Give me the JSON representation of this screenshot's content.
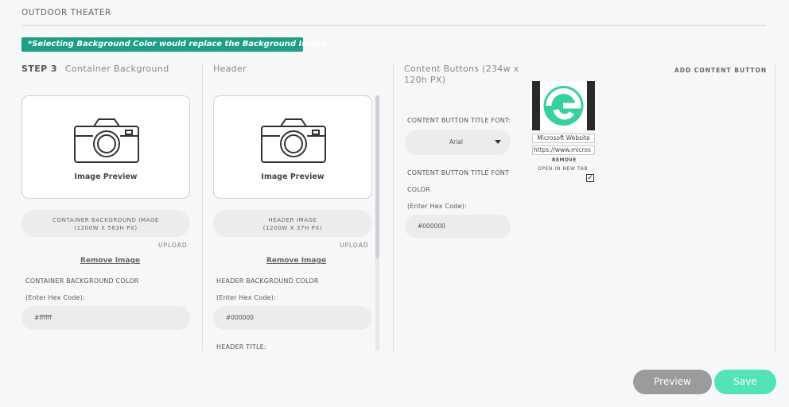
{
  "section": {
    "title": "OUTDOOR THEATER",
    "notice": "*Selecting Background Color would replace the Background Image."
  },
  "container_column": {
    "step": "STEP 3",
    "heading": "Container Background",
    "preview_label": "Image Preview",
    "upload_field_line1": "CONTAINER BACKGROUND IMAGE",
    "upload_field_line2": "(1200W X 563H PX)",
    "upload_link": "UPLOAD",
    "remove_link": "Remove Image",
    "color_label": "CONTAINER BACKGROUND COLOR",
    "hex_hint": "(Enter Hex Code):",
    "hex_value": "#ffffff"
  },
  "header_column": {
    "heading": "Header",
    "preview_label": "Image Preview",
    "upload_field_line1": "HEADER IMAGE",
    "upload_field_line2": "(1200W X 37H PX)",
    "upload_link": "UPLOAD",
    "remove_link": "Remove Image",
    "color_label": "HEADER BACKGROUND COLOR",
    "hex_hint": "(Enter Hex Code):",
    "hex_value": "#000000",
    "title_label": "HEADER TITLE:"
  },
  "buttons_column": {
    "heading_line1": "Content Buttons (234w x",
    "heading_line2": "120h PX)",
    "font_label": "CONTENT BUTTON TITLE FONT:",
    "font_value": "Arial",
    "color_label_line1": "CONTENT BUTTON TITLE FONT",
    "color_label_line2": "COLOR",
    "hex_hint": "(Enter Hex Code):",
    "hex_value": "#000000",
    "add_button": "ADD CONTENT BUTTON",
    "button_item": {
      "thumbnail_icon": "microsoft-edge-logo",
      "title": "Microsoft Website",
      "url": "https://www.micros",
      "remove": "REMOVE",
      "open_new_tab_label": "OPEN IN NEW TAB",
      "open_new_tab_checked": true
    }
  },
  "actions": {
    "preview": "Preview",
    "save": "Save"
  },
  "colors": {
    "notice_bg": "#1e9e86",
    "save_bg": "#53e3b8",
    "preview_bg": "#9a9b9d"
  }
}
